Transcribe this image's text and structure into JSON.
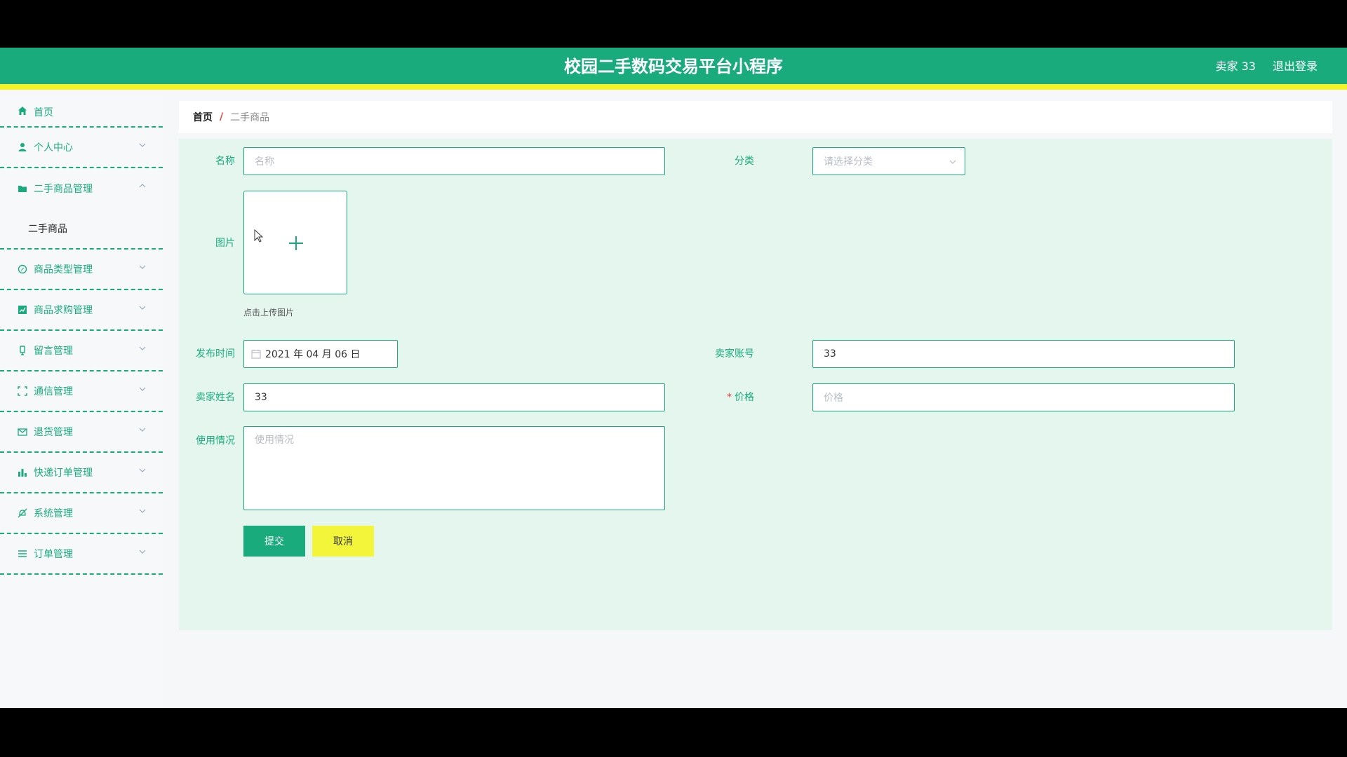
{
  "header": {
    "title": "校园二手数码交易平台小程序",
    "user_label": "卖家 33",
    "logout_label": "退出登录"
  },
  "sidebar": {
    "home": "首页",
    "items": [
      {
        "label": "个人中心",
        "icon": "user-icon"
      },
      {
        "label": "二手商品管理",
        "icon": "folder-icon",
        "expanded": true
      },
      {
        "label": "商品类型管理",
        "icon": "compass-icon"
      },
      {
        "label": "商品求购管理",
        "icon": "chart-icon"
      },
      {
        "label": "留言管理",
        "icon": "message-icon"
      },
      {
        "label": "通信管理",
        "icon": "scan-icon"
      },
      {
        "label": "退货管理",
        "icon": "mail-icon"
      },
      {
        "label": "快递订单管理",
        "icon": "bar-chart-icon"
      },
      {
        "label": "系统管理",
        "icon": "bell-off-icon"
      },
      {
        "label": "订单管理",
        "icon": "list-icon"
      }
    ],
    "submenu": {
      "label": "二手商品"
    }
  },
  "breadcrumb": {
    "home": "首页",
    "sep": "/",
    "current": "二手商品"
  },
  "form": {
    "name": {
      "label": "名称",
      "placeholder": "名称",
      "value": ""
    },
    "category": {
      "label": "分类",
      "placeholder": "请选择分类"
    },
    "image": {
      "label": "图片",
      "hint": "点击上传图片"
    },
    "publish_time": {
      "label": "发布时间",
      "value": "2021 年 04 月 06 日"
    },
    "seller_account": {
      "label": "卖家账号",
      "value": "33"
    },
    "seller_name": {
      "label": "卖家姓名",
      "value": "33"
    },
    "price": {
      "label": "价格",
      "required": "*",
      "placeholder": "价格"
    },
    "usage": {
      "label": "使用情况",
      "placeholder": "使用情况"
    },
    "submit_label": "提交",
    "cancel_label": "取消"
  },
  "colors": {
    "primary": "#1aab7d",
    "accent_yellow": "#f3f327",
    "panel": "#e5f6ee",
    "danger": "#e2473c"
  }
}
